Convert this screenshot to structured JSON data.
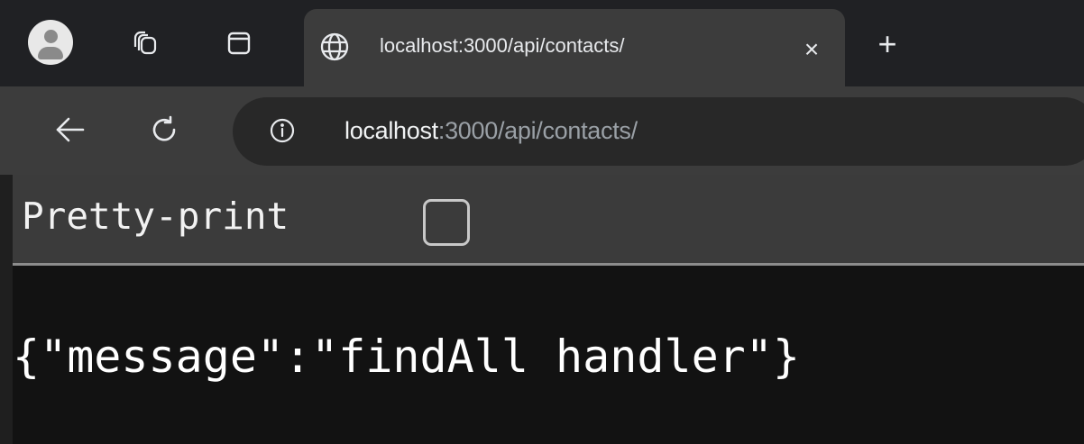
{
  "browser": {
    "tab": {
      "title": "localhost:3000/api/contacts/"
    },
    "tab_close_glyph": "×",
    "new_tab_glyph": "+",
    "address_bar": {
      "host": "localhost",
      "rest": ":3000/api/contacts/"
    },
    "icons": {
      "profile": "profile-avatar-icon",
      "workspaces": "workspaces-icon",
      "vertical_tabs": "sidebar-toggle-icon",
      "favicon": "globe-icon",
      "back": "back-arrow-icon",
      "reload": "reload-icon",
      "site_info": "info-icon"
    }
  },
  "page": {
    "pretty_print_label": "Pretty-print",
    "pretty_print_checked": false,
    "body_text": "{\"message\":\"findAll handler\"}"
  },
  "colors": {
    "tabstrip_bg": "#202124",
    "toolbar_bg": "#3c3c3c",
    "page_bg": "#121212"
  }
}
